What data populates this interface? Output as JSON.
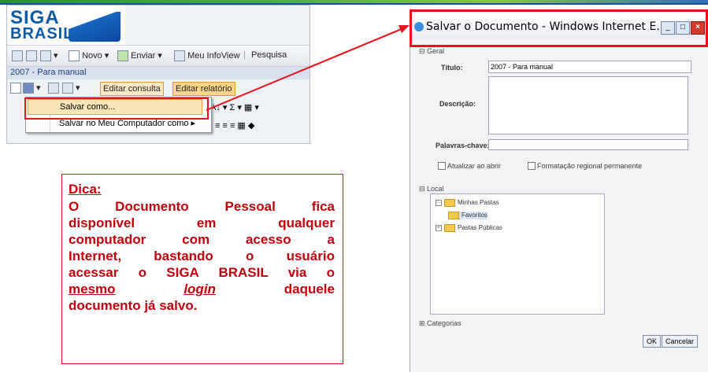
{
  "app": {
    "logo_line1": "SIGA",
    "logo_line2": "BRASIL",
    "toolbar1": {
      "novo": "Novo",
      "enviar": "Enviar",
      "meu_infoview": "Meu InfoView",
      "pesquisa": "Pesquisa"
    },
    "document_title": "2007 - Para manual",
    "toolbar2": {
      "editar_consulta": "Editar consulta",
      "editar_relatorio": "Editar relatório"
    },
    "menu": {
      "salvar_como": "Salvar como...",
      "salvar_computador": "Salvar no Meu Computador como"
    }
  },
  "tip": {
    "heading": "Dica:",
    "line1": "O Documento Pessoal fica",
    "line2": "disponível em qualquer",
    "line3": "computador com acesso a",
    "line4": "Internet, bastando o usuário",
    "line5": "acessar o SIGA BRASIL via o",
    "line6_a": "mesmo",
    "line6_b": "login",
    "line6_c": "daquele",
    "line7": "documento já salvo."
  },
  "dialog": {
    "title": "Salvar o Documento - Windows Internet E...",
    "section_geral": "Geral",
    "titulo_label": "Título:",
    "titulo_value": "2007 - Para manual",
    "descricao_label": "Descrição:",
    "palavras_label": "Palavras-chave:",
    "atualizar_label": "Atualizar ao abrir",
    "formatacao_label": "Formatação regional permanente",
    "section_local": "Local",
    "tree": {
      "minhas_pastas": "Minhas Pastas",
      "favoritos": "Favoritos",
      "pastas_publicas": "Pastas Públicas"
    },
    "section_categorias": "Categorias",
    "ok": "OK",
    "cancelar": "Cancelar"
  },
  "colors": {
    "highlight_red": "#e8101a",
    "tip_text": "#c0000b",
    "brand_blue": "#0b5aa8"
  }
}
